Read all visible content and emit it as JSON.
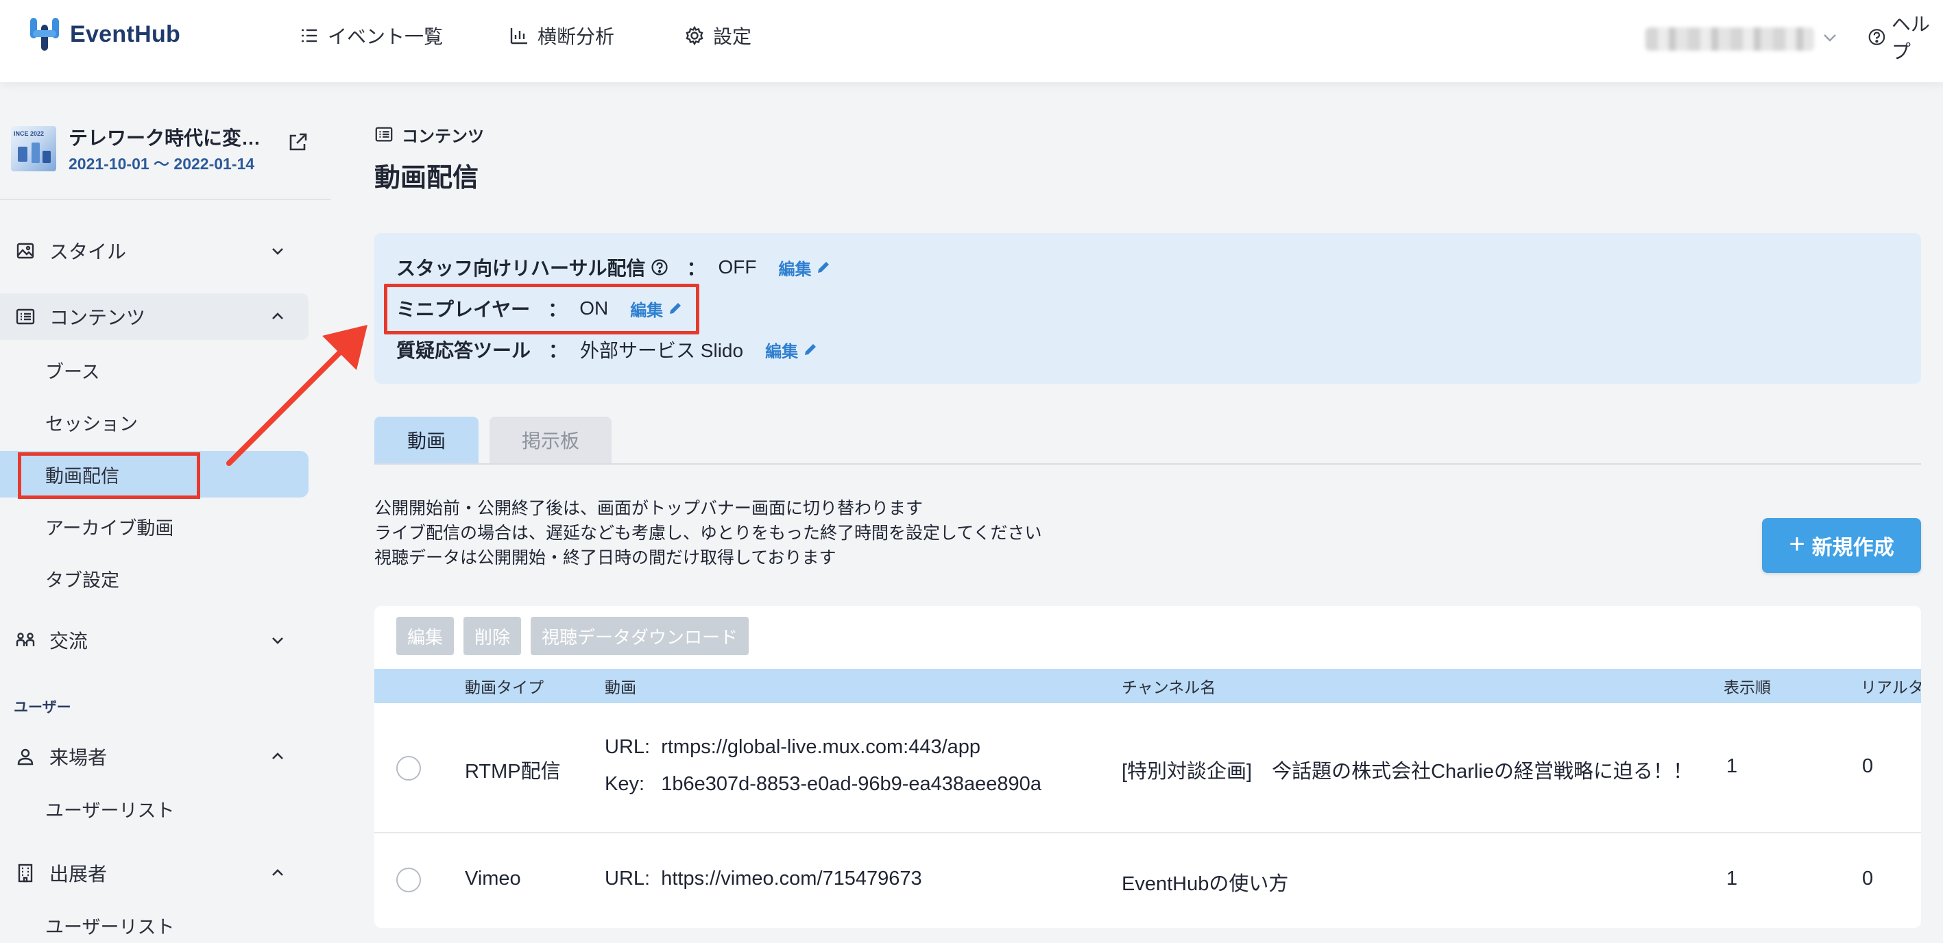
{
  "header": {
    "logo_text": "EventHub",
    "nav": [
      {
        "label": "イベント一覧",
        "icon": "list-icon"
      },
      {
        "label": "横断分析",
        "icon": "bar-chart-icon"
      },
      {
        "label": "設定",
        "icon": "gear-icon"
      }
    ],
    "help_label": "ヘルプ"
  },
  "sidebar": {
    "event": {
      "title": "テレワーク時代に変…",
      "dates": "2021-10-01 〜 2022-01-14",
      "thumb_text": "INCE 2022"
    },
    "sections": [
      {
        "label": "スタイル"
      },
      {
        "label": "コンテンツ"
      },
      {
        "label": "交流"
      }
    ],
    "content_items": [
      "ブース",
      "セッション",
      "動画配信",
      "アーカイブ動画",
      "タブ設定"
    ],
    "users_group": "ユーザー",
    "visitors": {
      "label": "来場者",
      "item": "ユーザーリスト"
    },
    "exhibitors": {
      "label": "出展者",
      "item": "ユーザーリスト"
    }
  },
  "main": {
    "breadcrumb": "コンテンツ",
    "title": "動画配信",
    "settings": [
      {
        "label": "スタッフ向けリハーサル配信",
        "colon": "：",
        "value": "OFF",
        "edit": "編集"
      },
      {
        "label": "ミニプレイヤー",
        "colon": "：",
        "value": "ON",
        "edit": "編集"
      },
      {
        "label": "質疑応答ツール",
        "colon": "：",
        "value": "外部サービス Slido",
        "edit": "編集"
      }
    ],
    "tabs": [
      "動画",
      "掲示板"
    ],
    "notes": [
      "公開開始前・公開終了後は、画面がトップバナー画面に切り替わります",
      "ライブ配信の場合は、遅延なども考慮し、ゆとりをもった終了時間を設定してください",
      "視聴データは公開開始・終了日時の間だけ取得しております"
    ],
    "new_button": "新規作成",
    "table": {
      "actions": [
        "編集",
        "削除",
        "視聴データダウンロード"
      ],
      "columns": [
        "動画タイプ",
        "動画",
        "チャンネル名",
        "表示順",
        "リアルタ"
      ],
      "rows": [
        {
          "type": "RTMP配信",
          "url_label": "URL:",
          "url": "rtmps://global-live.mux.com:443/app",
          "key_label": "Key:",
          "key": "1b6e307d-8853-e0ad-96b9-ea438aee890a",
          "channel": "[特別対談企画]　今話題の株式会社Charlieの経営戦略に迫る！！",
          "order": "1",
          "realtime": "0"
        },
        {
          "type": "Vimeo",
          "url_label": "URL:",
          "url": "https://vimeo.com/715479673",
          "channel": "EventHubの使い方",
          "order": "1",
          "realtime": "0"
        }
      ]
    }
  },
  "colors": {
    "accent": "#41a1e6",
    "highlight": "#e63a2e",
    "selected_bg": "#bfdcf7",
    "panel_bg": "#e1eefa"
  }
}
